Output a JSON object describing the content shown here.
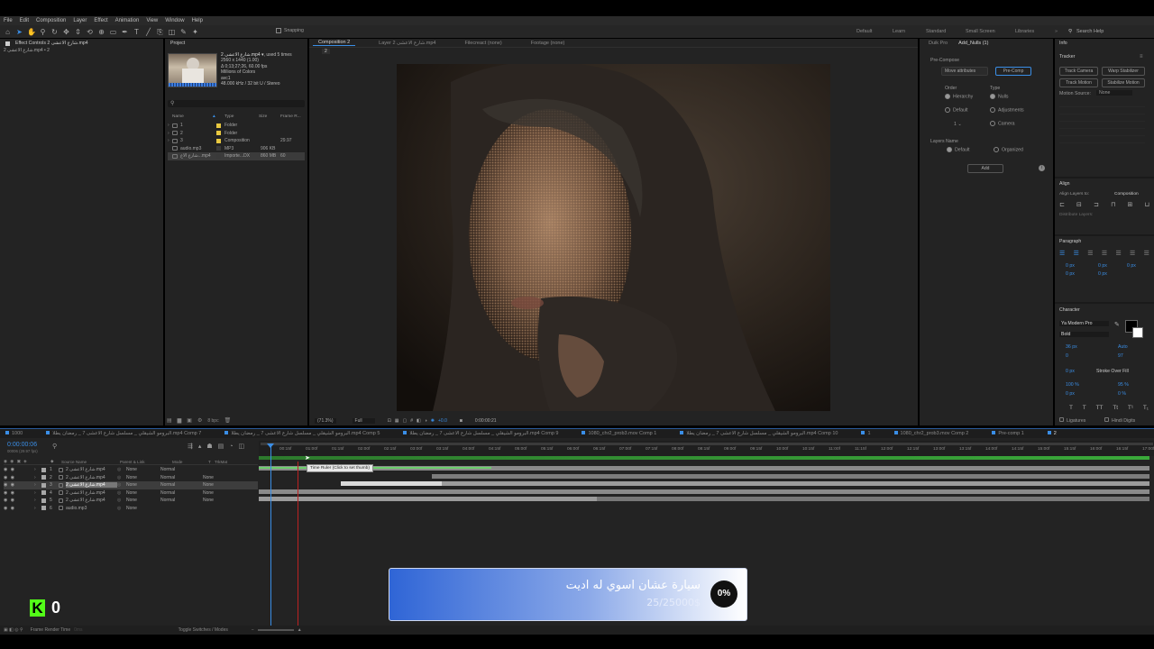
{
  "menu": [
    "File",
    "Edit",
    "Composition",
    "Layer",
    "Effect",
    "Animation",
    "View",
    "Window",
    "Help"
  ],
  "toolbar": {
    "snapping": "Snapping",
    "workspaces": [
      "Default",
      "Learn",
      "Standard",
      "Small Screen",
      "Libraries"
    ],
    "search_help": "Search Help"
  },
  "effect_controls": {
    "tab": "Effect Controls شارع الاعشى 2.mp4",
    "layer": "شارع الاعشى 2.mp4 • 2"
  },
  "project": {
    "tab": "Project",
    "file_name": "شارع الاعشى 2.mp4 ▾",
    "used": ", used 5 times",
    "info_lines": [
      "2560 x 1440 (1.00)",
      "Δ 0;13;27;26, 60.00 fps",
      "Millions of Colors",
      "avc1",
      "48.000 kHz / 32 bit U / Stereo"
    ],
    "columns": [
      "Name",
      "Type",
      "Size",
      "Frame R..."
    ],
    "items": [
      {
        "name": "1",
        "type": "Folder",
        "size": "",
        "fr": "",
        "color": "#e8c840"
      },
      {
        "name": "2",
        "type": "Folder",
        "size": "",
        "fr": "",
        "color": "#e8c840"
      },
      {
        "name": "3",
        "type": "Composition",
        "size": "",
        "fr": "29.97",
        "color": "#e8c840"
      },
      {
        "name": "audio.mp3",
        "type": "MP3",
        "size": "906 KB",
        "fr": "",
        "color": "#3a3a3a"
      },
      {
        "name": "شارع الاع...mp4",
        "type": "Importe...DX",
        "size": "860 MB",
        "fr": "60",
        "color": "#3a3a3a"
      }
    ],
    "bpc": "8 bpc"
  },
  "viewer": {
    "tabs": [
      "Composition 2",
      "Layer شارع الاعشى 2.mp4",
      "Filecreact (none)",
      "Footage (none)"
    ],
    "breadcrumb": "2",
    "zoom": "(71.3%)",
    "resolution": "Full",
    "exposure": "+0.0",
    "timecode": "0:00:00:21"
  },
  "scripts": {
    "tabs": [
      "Duik Pro",
      "Add_Nulls (1)"
    ],
    "precompose": "Pre-Compose",
    "move_attributes": "Move attributes",
    "precomp_btn": "Pre-Comp",
    "order": "Order",
    "type": "Type",
    "hierarchy": "Hierarchy",
    "default": "Default",
    "nulls": "Nulls",
    "adjustments": "Adjustments",
    "camera": "Camera",
    "count": "1",
    "layers_name": "Layers Name",
    "default2": "Default",
    "organized": "Organized",
    "add": "Add"
  },
  "right": {
    "info": "Info",
    "tracker": "Tracker",
    "track_camera": "Track Camera",
    "warp_stabilizer": "Warp Stabilizer",
    "track_motion": "Track Motion",
    "stabilize_motion": "Stabilize Motion",
    "motion_source": "Motion Source:",
    "motion_source_val": "None",
    "align": "Align",
    "align_layers_to": "Align Layers to:",
    "align_target": "Composition",
    "distribute_layers": "Distribute Layers:",
    "paragraph": "Paragraph",
    "para_vals": [
      "0 px",
      "0 px",
      "0 px",
      "0 px",
      "0 px"
    ],
    "character": "Character",
    "font": "Ya Modern Pro",
    "style": "Bold",
    "font_size": "36 px",
    "leading": "Auto",
    "kerning": "0",
    "tracking": "97",
    "stroke_width": "0 px",
    "stroke_mode": "Stroke Over Fill",
    "v_scale": "100 %",
    "h_scale": "95 %",
    "baseline": "0 px",
    "tsume": "0 %",
    "ligatures": "Ligatures",
    "hindi_digits": "Hindi Digits"
  },
  "timeline": {
    "tabs": [
      "1000",
      "البرومو الشيقلي _ مسلسل شارع الاعشى 7 _ رمضان يطلا.mp4 Comp 7",
      "البرومو الشيقلي _ مسلسل شارع الاعشى 7 _ رمضان يطلا.mp4 Comp 5",
      "البرومو الشيقلي _ مسلسل شارع الاعشى 7 _ رمضان يطلا.mp4 Comp 9",
      "1080_chr2_prob3.mov Comp 1",
      "البرومو الشيقلي _ مسلسل شارع الاعشى 7 _ رمضان يطلا.mp4 Comp 10",
      "1",
      "1080_chr2_prob3.mov Comp 2",
      "Pre-comp 1",
      "2"
    ],
    "timecode": "0:00:00:06",
    "fps": "00006 (29.97 fps)",
    "columns": {
      "source": "Source Name",
      "parent": "Parent & Link",
      "mode": "Mode",
      "t": "T",
      "trkmat": "TrkMat"
    },
    "layers": [
      {
        "num": "1",
        "name": "شارع الاعشى 2.mp4",
        "parent": "None",
        "mode": "Normal",
        "trk": "",
        "sel": false
      },
      {
        "num": "2",
        "name": "شارع الاعشى 2.mp4",
        "parent": "None",
        "mode": "Normal",
        "trk": "None",
        "sel": false
      },
      {
        "num": "3",
        "name": "شارع الاعشى 2.mp4",
        "parent": "None",
        "mode": "Normal",
        "trk": "None",
        "sel": true
      },
      {
        "num": "4",
        "name": "شارع الاعشى 2.mp4",
        "parent": "None",
        "mode": "Normal",
        "trk": "None",
        "sel": false
      },
      {
        "num": "5",
        "name": "شارع الاعشى 2.mp4",
        "parent": "None",
        "mode": "Normal",
        "trk": "None",
        "sel": false
      },
      {
        "num": "6",
        "name": "audio.mp3",
        "parent": "None",
        "mode": "",
        "trk": "",
        "sel": false
      }
    ],
    "ticks": [
      "00:15f",
      "01:00f",
      "01:15f",
      "02:00f",
      "02:15f",
      "03:00f",
      "03:15f",
      "04:00f",
      "04:15f",
      "05:00f",
      "05:15f",
      "06:00f",
      "06:15f",
      "07:00f",
      "07:15f",
      "08:00f",
      "08:15f",
      "09:00f",
      "09:15f",
      "10:00f",
      "10:15f",
      "11:00f",
      "11:15f",
      "12:00f",
      "12:15f",
      "13:00f",
      "13:15f",
      "14:00f",
      "14:15f",
      "15:00f",
      "15:15f",
      "16:00f",
      "16:15f",
      "17:00f"
    ],
    "tooltip": "Time Ruler (Click to set thumb)",
    "frame_render_time": "Frame Render Time",
    "frame_render_val": "0ms",
    "toggle": "Toggle Switches / Modes"
  },
  "overlay": {
    "logo_letter": "K",
    "logo_count": "0",
    "donation_text": "سيارة عشان اسوي له اديت",
    "donation_amount": "25/25000$",
    "donation_percent": "0%"
  }
}
